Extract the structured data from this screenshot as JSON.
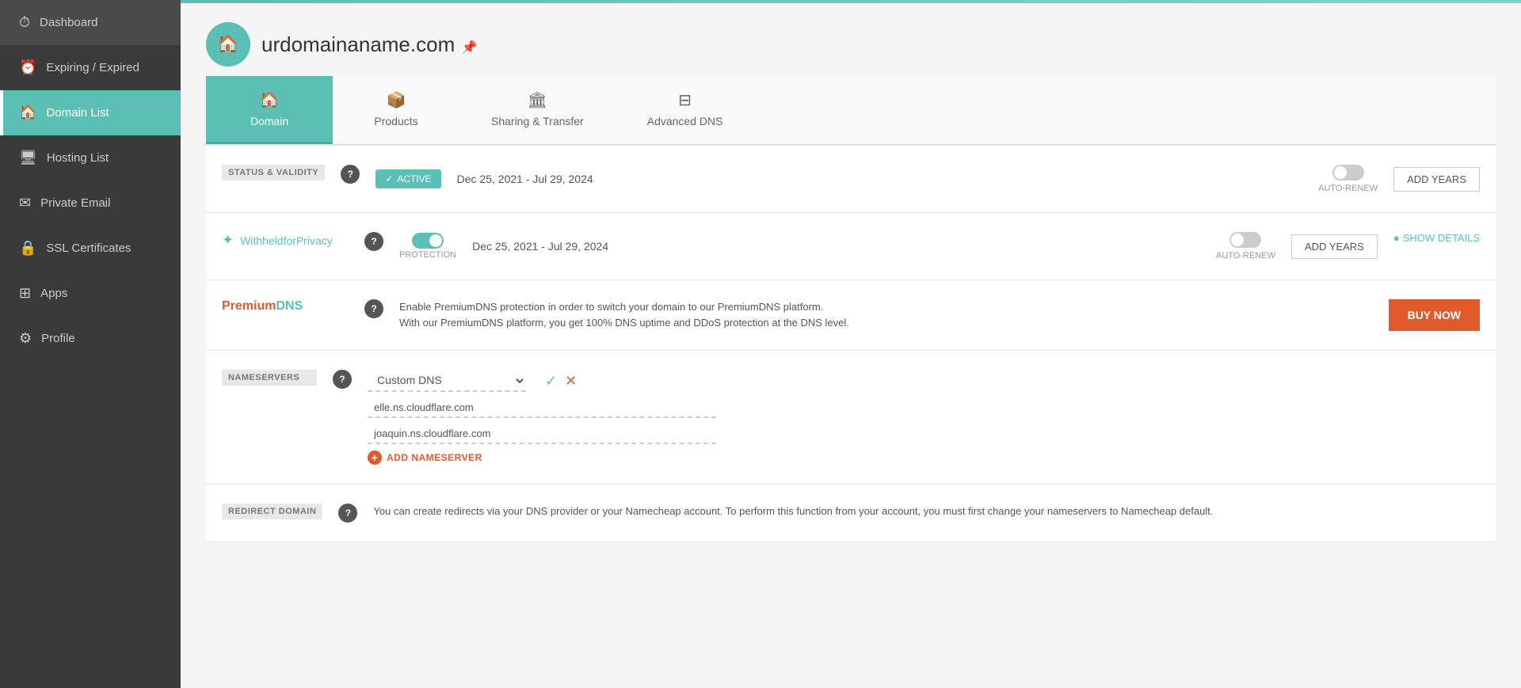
{
  "sidebar": {
    "items": [
      {
        "id": "dashboard",
        "label": "Dashboard",
        "icon": "⏱",
        "active": false
      },
      {
        "id": "expiring",
        "label": "Expiring / Expired",
        "icon": "⏰",
        "active": false
      },
      {
        "id": "domain-list",
        "label": "Domain List",
        "icon": "🏠",
        "active": true
      },
      {
        "id": "hosting-list",
        "label": "Hosting List",
        "icon": "🖥",
        "active": false
      },
      {
        "id": "private-email",
        "label": "Private Email",
        "icon": "✉",
        "active": false
      },
      {
        "id": "ssl-certificates",
        "label": "SSL Certificates",
        "icon": "🔒",
        "active": false
      },
      {
        "id": "apps",
        "label": "Apps",
        "icon": "⊞",
        "active": false
      },
      {
        "id": "profile",
        "label": "Profile",
        "icon": "⚙",
        "active": false
      }
    ]
  },
  "domain": {
    "name": "urdomainaname.com"
  },
  "tabs": [
    {
      "id": "domain",
      "label": "Domain",
      "icon": "🏠",
      "active": true
    },
    {
      "id": "products",
      "label": "Products",
      "icon": "📦",
      "active": false
    },
    {
      "id": "sharing-transfer",
      "label": "Sharing & Transfer",
      "icon": "🏛",
      "active": false
    },
    {
      "id": "advanced-dns",
      "label": "Advanced DNS",
      "icon": "⊟",
      "active": false
    }
  ],
  "sections": {
    "status_validity": {
      "label": "STATUS & VALIDITY",
      "status": "ACTIVE",
      "date_range": "Dec 25, 2021 - Jul 29, 2024",
      "auto_renew_label": "AUTO-RENEW",
      "add_years_btn": "ADD YEARS",
      "auto_renew_on": false
    },
    "privacy": {
      "brand": "WithheldforPrivacy",
      "date_range": "Dec 25, 2021 - Jul 29, 2024",
      "protection_label": "PROTECTION",
      "auto_renew_label": "AUTO-RENEW",
      "add_years_btn": "ADD YEARS",
      "show_details": "SHOW DETAILS",
      "protection_on": true,
      "auto_renew_on": false
    },
    "premium_dns": {
      "brand_part1": "Premium",
      "brand_part2": "DNS",
      "description_line1": "Enable PremiumDNS protection in order to switch your domain to our PremiumDNS platform.",
      "description_line2": "With our PremiumDNS platform, you get 100% DNS uptime and DDoS protection at the DNS level.",
      "buy_btn": "BUY NOW"
    },
    "nameservers": {
      "label": "NAMESERVERS",
      "dns_type": "Custom DNS",
      "ns1": "elle.ns.cloudflare.com",
      "ns2": "joaquin.ns.cloudflare.com",
      "add_nameserver": "ADD NAMESERVER"
    },
    "redirect_domain": {
      "label": "REDIRECT DOMAIN",
      "description": "You can create redirects via your DNS provider or your Namecheap account. To perform this function from your account, you must first change your nameservers to Namecheap default."
    }
  }
}
